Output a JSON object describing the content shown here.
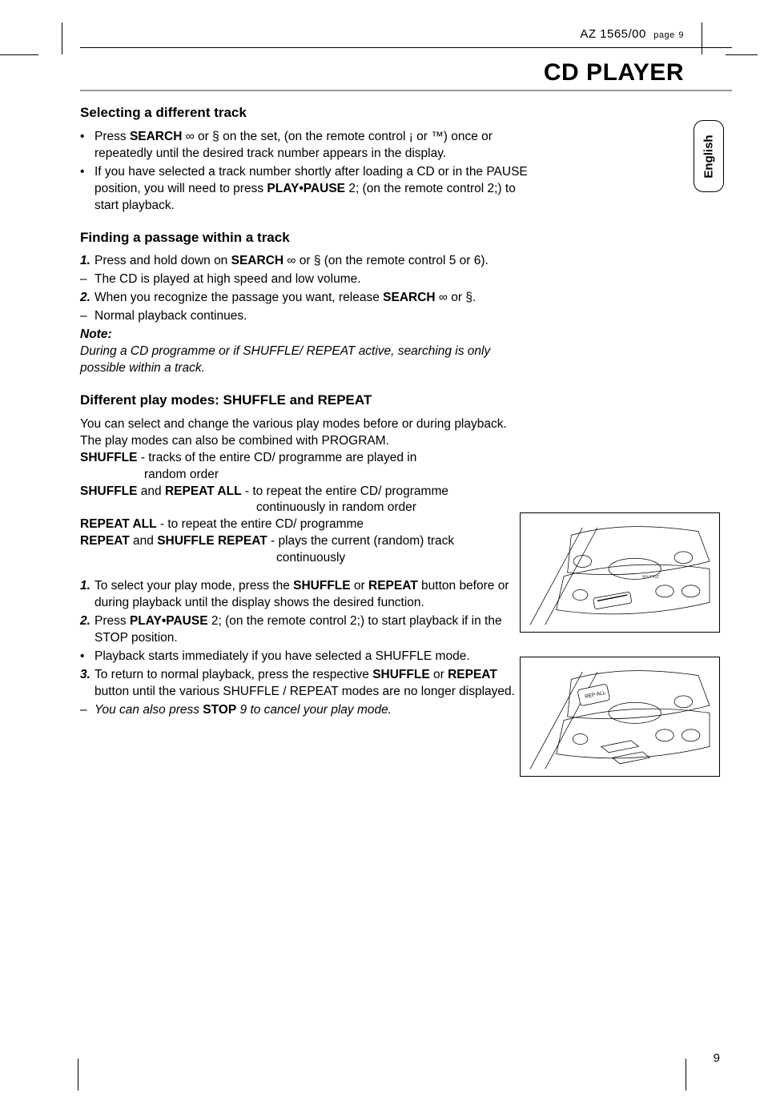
{
  "header": {
    "model": "AZ 1565/00",
    "page_small": "page",
    "page_num_top": "9"
  },
  "section_title": "CD PLAYER",
  "lang_tab": "English",
  "h1": "Selecting a different track",
  "b1a_pre": "Press ",
  "b1a_search": "SEARCH",
  "b1a_mid": " ∞ or § on the set, (on the remote control ¡ or ™) once or repeatedly until the desired track number appears in the display.",
  "b1b_pre": "If you have selected a track number shortly after loading a CD or in the PAUSE position, you will need to press ",
  "b1b_pp": "PLAY•PAUSE",
  "b1b_post": " 2; (on the remote control 2;) to start playback.",
  "h2": "Finding a passage within a track",
  "s2_1_pre": "Press and hold down on ",
  "s2_1_search": "SEARCH",
  "s2_1_post": " ∞ or § (on the remote control 5 or 6).",
  "s2_dash1": "The CD is played at high speed and low volume.",
  "s2_2_pre": "When you recognize the passage you want, release ",
  "s2_2_search": "SEARCH",
  "s2_2_post": " ∞ or §.",
  "s2_dash2": "Normal playback continues.",
  "note_label": "Note:",
  "note_text": "During a CD programme or if SHUFFLE/ REPEAT active, searching is only possible within a track.",
  "h3": "Different play modes: SHUFFLE and REPEAT",
  "p3_intro": "You can select and change the various play modes before or during playback. The play modes can also be combined with PROGRAM.",
  "m1a": "SHUFFLE",
  "m1b": " - tracks of the entire CD/ programme are played in",
  "m1c": "random order",
  "m2a": "SHUFFLE",
  "m2and": " and ",
  "m2b": "REPEAT ALL",
  "m2c": " - to repeat the entire CD/ programme",
  "m2d": "continuously in random order",
  "m3a": "REPEAT ALL",
  "m3b": " - to repeat the entire CD/ programme",
  "m4a": "REPEAT",
  "m4and": " and ",
  "m4b": "SHUFFLE REPEAT",
  "m4c": " - plays the current (random) track",
  "m4d": "continuously",
  "s3_1_pre": "To select your play mode, press the ",
  "s3_1_sh": "SHUFFLE",
  "s3_1_or": " or ",
  "s3_1_rp": "REPEAT",
  "s3_1_post": " button before or during playback until the display shows the desired function.",
  "s3_2_pre": "Press ",
  "s3_2_pp": "PLAY•PAUSE",
  "s3_2_post": " 2; (on the remote control 2;) to start playback if in the STOP position.",
  "s3_bullet": "Playback starts immediately if you have selected a SHUFFLE mode.",
  "s3_3_pre": "To return to normal playback, press the respective ",
  "s3_3_sh": "SHUFFLE",
  "s3_3_or": " or ",
  "s3_3_rp": "REPEAT",
  "s3_3_post": " button until the various SHUFFLE / REPEAT modes are no longer displayed.",
  "s3_dash_pre": "You can also press ",
  "s3_dash_stop": "STOP",
  "s3_dash_post": " 9 to cancel your play mode.",
  "page_number": "9"
}
